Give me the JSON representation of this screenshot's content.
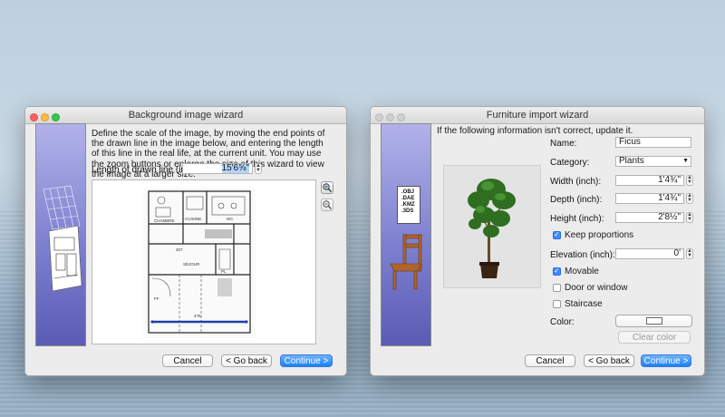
{
  "bg_wizard": {
    "title": "Background image wizard",
    "instructions": "Define the scale of the image, by moving the end points of the drawn line in the image below, and entering the length of this line in the real life, at the current unit. You may use the zoom buttons or enlarge the size of this wizard to view the image at a larger size.",
    "length_label": "Length of drawn line (inch):",
    "length_value": "15'6⅝\"",
    "plan_texts": [
      "CHAMBRE",
      "CUISINE",
      "SÉJOUR",
      "WC",
      "PL",
      "FF",
      "307",
      "476"
    ],
    "buttons": {
      "cancel": "Cancel",
      "back": "< Go back",
      "continue": "Continue >"
    }
  },
  "furniture_wizard": {
    "title": "Furniture import wizard",
    "info": "If the following information isn't correct, update it.",
    "file_types": [
      ".OBJ",
      ".DAE",
      ".KMZ",
      ".3DS"
    ],
    "fields": {
      "name": {
        "label": "Name:",
        "value": "Ficus"
      },
      "category": {
        "label": "Category:",
        "value": "Plants"
      },
      "width": {
        "label": "Width (inch):",
        "value": "1'4¾\""
      },
      "depth": {
        "label": "Depth (inch):",
        "value": "1'4¾\""
      },
      "height": {
        "label": "Height (inch):",
        "value": "2'8½\""
      },
      "elevation": {
        "label": "Elevation (inch):",
        "value": "0'"
      }
    },
    "checkboxes": {
      "keep_proportions": {
        "label": "Keep proportions",
        "checked": true
      },
      "movable": {
        "label": "Movable",
        "checked": true
      },
      "door_window": {
        "label": "Door or window",
        "checked": false
      },
      "staircase": {
        "label": "Staircase",
        "checked": false
      }
    },
    "color_label": "Color:",
    "clear_color": "Clear color",
    "buttons": {
      "cancel": "Cancel",
      "back": "< Go back",
      "continue": "Continue >"
    }
  },
  "colors": {
    "accent": "#1a82fb",
    "sidebar": "#7d7fcf",
    "scale_line": "#1f3fa8"
  }
}
